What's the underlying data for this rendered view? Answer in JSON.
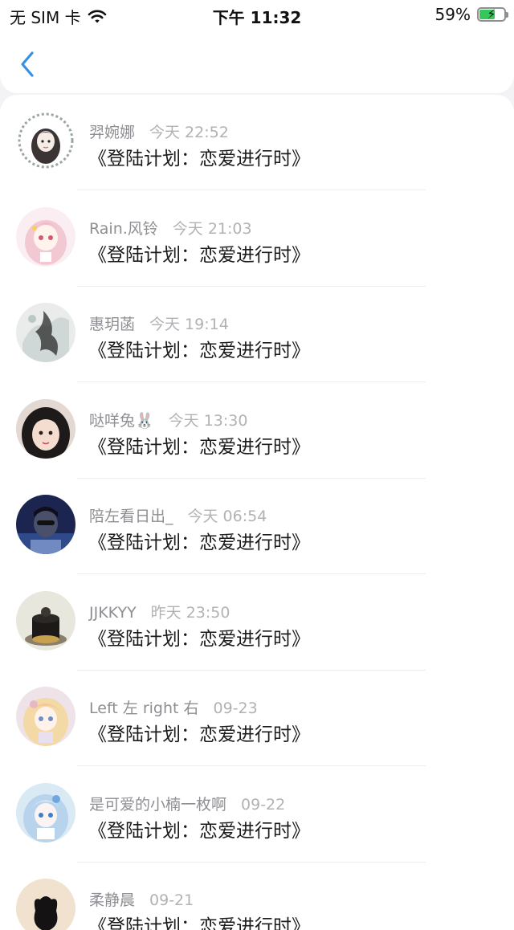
{
  "status_bar": {
    "carrier": "无 SIM 卡",
    "time": "下午 11:32",
    "battery_percent": "59%",
    "battery_level": 0.59,
    "icons": [
      "wifi-icon",
      "battery-charging-icon"
    ]
  },
  "nav": {
    "back_icon": "chevron-left-icon",
    "accent": "#3a8ee6"
  },
  "list": [
    {
      "name": "羿婉娜",
      "time": "今天 22:52",
      "message": "《登陆计划：恋爱进行时》"
    },
    {
      "name": "Rain.风铃",
      "time": "今天 21:03",
      "message": "《登陆计划：恋爱进行时》"
    },
    {
      "name": "惠玥菡",
      "time": "今天 19:14",
      "message": "《登陆计划：恋爱进行时》"
    },
    {
      "name": "哒咩兔🐰",
      "time": "今天 13:30",
      "message": "《登陆计划：恋爱进行时》"
    },
    {
      "name": "陪左看日出_",
      "time": "今天 06:54",
      "message": "《登陆计划：恋爱进行时》"
    },
    {
      "name": "JJKKYY",
      "time": "昨天 23:50",
      "message": "《登陆计划：恋爱进行时》"
    },
    {
      "name": "Left 左 right 右",
      "time": "09-23",
      "message": "《登陆计划：恋爱进行时》"
    },
    {
      "name": "是可爱的小楠一枚啊",
      "time": "09-22",
      "message": "《登陆计划：恋爱进行时》"
    },
    {
      "name": "柔静晨",
      "time": "09-21",
      "message": "《登陆计划：恋爱进行时》"
    }
  ]
}
